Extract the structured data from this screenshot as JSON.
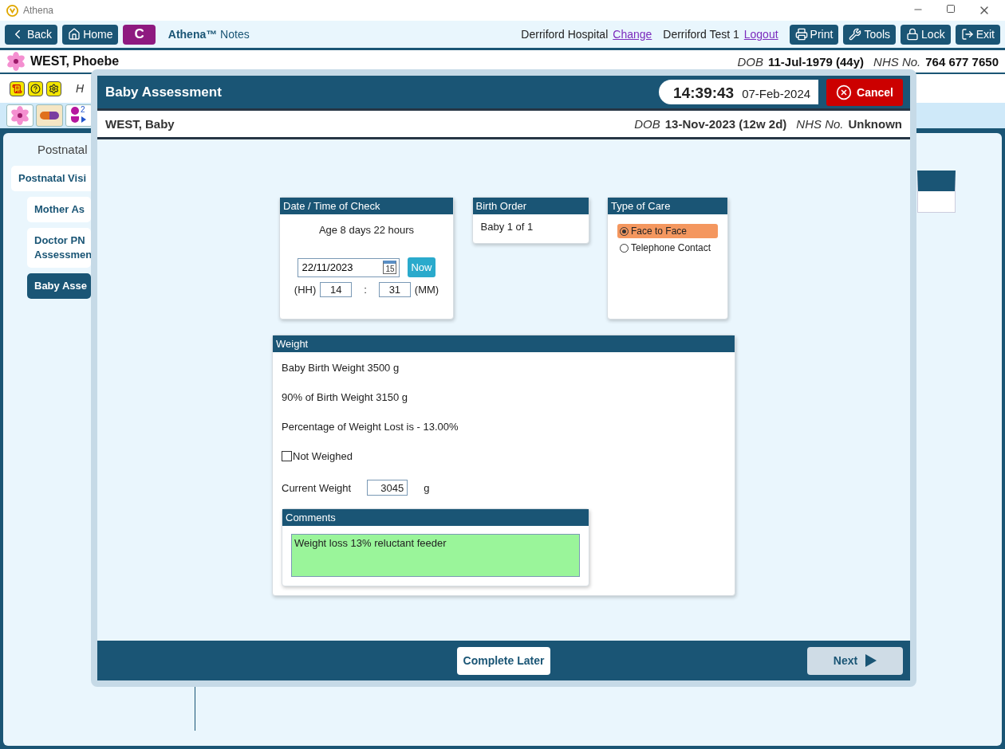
{
  "app": {
    "title": "Athena"
  },
  "toolbar": {
    "nav": [
      {
        "kind": "back",
        "label": "Back"
      },
      {
        "kind": "home",
        "label": "Home"
      },
      {
        "kind": "badge",
        "label": "C"
      }
    ],
    "brand": "Athena™",
    "brand_suffix": "Notes",
    "site": "Derriford Hospital",
    "site_link": "Change",
    "user": "Derriford Test 1",
    "user_link": "Logout",
    "actions": [
      {
        "kind": "print",
        "label": "Print"
      },
      {
        "kind": "tools",
        "label": "Tools"
      },
      {
        "kind": "lock",
        "label": "Lock"
      },
      {
        "kind": "exit",
        "label": "Exit"
      }
    ]
  },
  "patient": {
    "name": "WEST, Phoebe",
    "dob_label": "DOB",
    "dob": "11-Jul-1979 (44y)",
    "nhs_label": "NHS No.",
    "nhs": "764 677 7650"
  },
  "alerts": {
    "icons": [
      {
        "kind": "document"
      },
      {
        "kind": "help"
      },
      {
        "kind": "settings"
      }
    ],
    "text": "H"
  },
  "quick_tabs": [
    {
      "kind": "flower"
    },
    {
      "kind": "pill"
    },
    {
      "kind": "babies",
      "count": "2"
    }
  ],
  "sidebar": {
    "heading": "Postnatal",
    "items": [
      {
        "label": "Postnatal Visi",
        "selected": false,
        "children": [
          {
            "label": "Mother As",
            "selected": false
          },
          {
            "label": "Doctor PN\nAssessmen",
            "selected": false
          },
          {
            "label": "Baby Asse",
            "selected": true
          }
        ]
      }
    ]
  },
  "modal": {
    "title": "Baby Assessment",
    "time": "14:39:43",
    "date": "07-Feb-2024",
    "cancel": "Cancel",
    "baby": {
      "name": "WEST, Baby",
      "dob_label": "DOB",
      "dob": "13-Nov-2023 (12w 2d)",
      "nhs_label": "NHS No.",
      "nhs": "Unknown"
    },
    "check": {
      "title": "Date / Time of Check",
      "age": "Age 8 days 22 hours",
      "date": "22/11/2023",
      "calendar_day": "15",
      "now": "Now",
      "hh_label": "(HH)",
      "hour": "14",
      "separator": ":",
      "minute": "31",
      "mm_label": "(MM)"
    },
    "birth_order": {
      "title": "Birth Order",
      "value": "Baby 1 of 1"
    },
    "care": {
      "title": "Type of Care",
      "options": [
        {
          "label": "Face to Face",
          "selected": true
        },
        {
          "label": "Telephone Contact",
          "selected": false
        }
      ]
    },
    "weight": {
      "title": "Weight",
      "lines": [
        "Baby Birth Weight 3500 g",
        "90% of Birth Weight 3150 g",
        "Percentage of Weight Lost is - 13.00%"
      ],
      "not_weighed": {
        "label": "Not Weighed",
        "checked": false
      },
      "current_label": "Current Weight",
      "current_value": "3045",
      "unit": "g",
      "comments": {
        "title": "Comments",
        "value": "Weight loss 13% reluctant feeder"
      }
    },
    "footer": {
      "complete_later": "Complete Later",
      "next": "Next"
    }
  }
}
